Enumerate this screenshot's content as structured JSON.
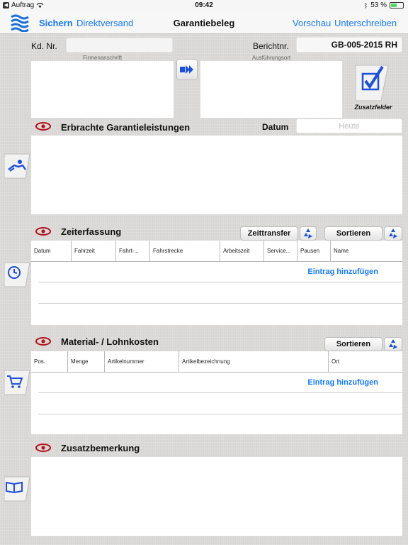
{
  "status": {
    "carrier": "Auftrag",
    "time": "09:42",
    "battery": "53 %",
    "battery_level": 0.53
  },
  "nav": {
    "save": "Sichern",
    "direct_send": "Direktversand",
    "title": "Garantiebeleg",
    "preview": "Vorschau",
    "sign": "Unterschreiben"
  },
  "header": {
    "customer_label": "Kd. Nr.",
    "customer_value": "",
    "report_label": "Berichtnr.",
    "report_value": "GB-005-2015 RH",
    "company_address_label": "Firmenanschrift",
    "execution_site_label": "Ausführungsort",
    "extra_fields_label": "Zusatzfelder"
  },
  "warranty": {
    "title": "Erbrachte Garantieleistungen",
    "date_label": "Datum",
    "date_placeholder": "Heute"
  },
  "time_tracking": {
    "title": "Zeiterfassung",
    "transfer_btn": "Zeittransfer",
    "sort_btn": "Sortieren",
    "columns": [
      "Datum",
      "Fahrzeit",
      "Fahrt-...",
      "Fahrstrecke",
      "Arbeitszeit",
      "Service...",
      "Pausen",
      "Name"
    ],
    "add_entry": "Eintrag hinzufügen"
  },
  "material": {
    "title": "Material- / Lohnkosten",
    "sort_btn": "Sortieren",
    "columns": [
      "Pos.",
      "Menge",
      "Artikelnummer",
      "Artikelbezeichnung",
      "Ort"
    ],
    "add_entry": "Eintrag hinzufügen"
  },
  "remarks": {
    "title": "Zusatzbemerkung"
  },
  "colors": {
    "accent": "#1479ff",
    "eye": "#b3121b",
    "icon_blue": "#1d4fd8"
  },
  "icons": {
    "app_logo": "waves-logo-icon",
    "arrow": "double-arrow-right-icon",
    "checkbox": "checkbox-check-icon",
    "eye": "eye-icon",
    "recycle": "recycle-icon",
    "worker": "worker-icon",
    "clock": "clock-icon",
    "cart": "cart-icon",
    "book": "book-icon"
  }
}
